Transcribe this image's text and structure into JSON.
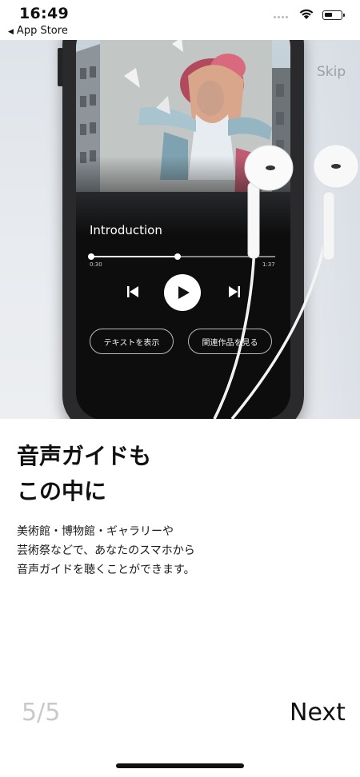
{
  "status_bar": {
    "time": "16:49",
    "back_app": "App Store"
  },
  "hero": {
    "skip_label": "Skip",
    "player": {
      "track_title": "Introduction",
      "time_elapsed": "0:30",
      "time_total": "1:37",
      "progress": 0.47,
      "show_text_label": "テキストを表示",
      "related_label": "関連作品を見る"
    }
  },
  "content": {
    "headline_line1": "音声ガイドも",
    "headline_line2": "この中に",
    "body_line1": "美術館・博物館・ギャラリーや",
    "body_line2": "芸術祭などで、あなたのスマホから",
    "body_line3": "音声ガイドを聴くことができます。"
  },
  "footer": {
    "page_indicator": "5/5",
    "next_label": "Next"
  }
}
